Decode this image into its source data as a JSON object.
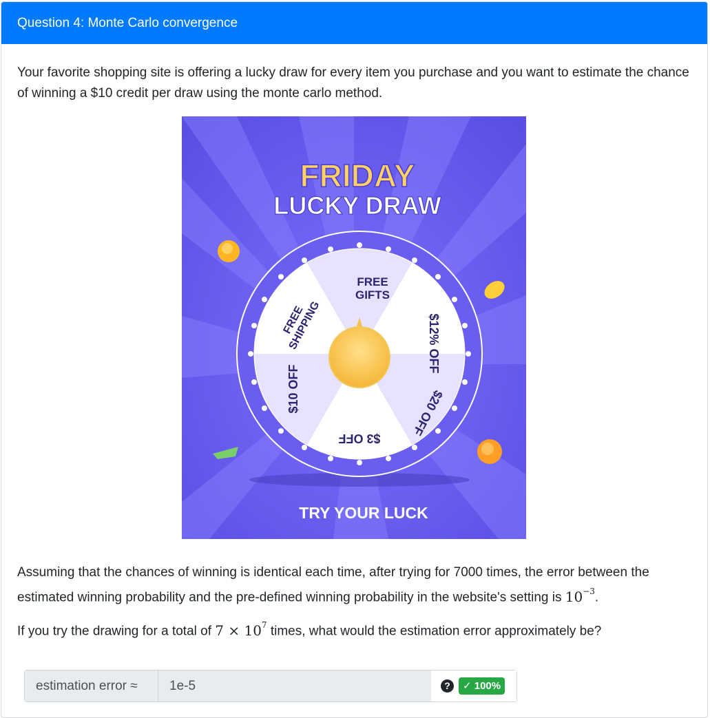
{
  "header": {
    "title": "Question 4: Monte Carlo convergence"
  },
  "question": {
    "intro": "Your favorite shopping site is offering a lucky draw for every item you purchase and you want to estimate the chance of winning a $10 credit per draw using the monte carlo method.",
    "assumption_line1": "Assuming that the chances of winning is identical each time, after trying for 7000 times, the error between the",
    "assumption_line2_text": "estimated winning probability and the pre-defined winning probability in the website's setting is",
    "assumption_math_base": "10",
    "assumption_math_exp": "−3",
    "assumption_end": ".",
    "prompt_before": "If you try the drawing for a total of",
    "prompt_math_a": "7 × 10",
    "prompt_math_exp": "7",
    "prompt_after": "times, what would the estimation error approximately be?"
  },
  "image": {
    "title_top": "FRIDAY",
    "title_bottom": "LUCKY DRAW",
    "footer": "TRY YOUR LUCK",
    "segments": [
      "FREE",
      "GIFTS",
      "$12% OFF",
      "$20 OFF",
      "$3 OFF",
      "$10 OFF",
      "FREE",
      "SHIPPING"
    ]
  },
  "answer": {
    "label": "estimation error ≈",
    "value": "1e-5",
    "help_icon": "?",
    "score": "✓ 100%"
  },
  "colors": {
    "header_bg": "#007bff",
    "poster_bg": "#6a5ff3",
    "poster_title": "#ffd166",
    "success": "#28a745"
  }
}
